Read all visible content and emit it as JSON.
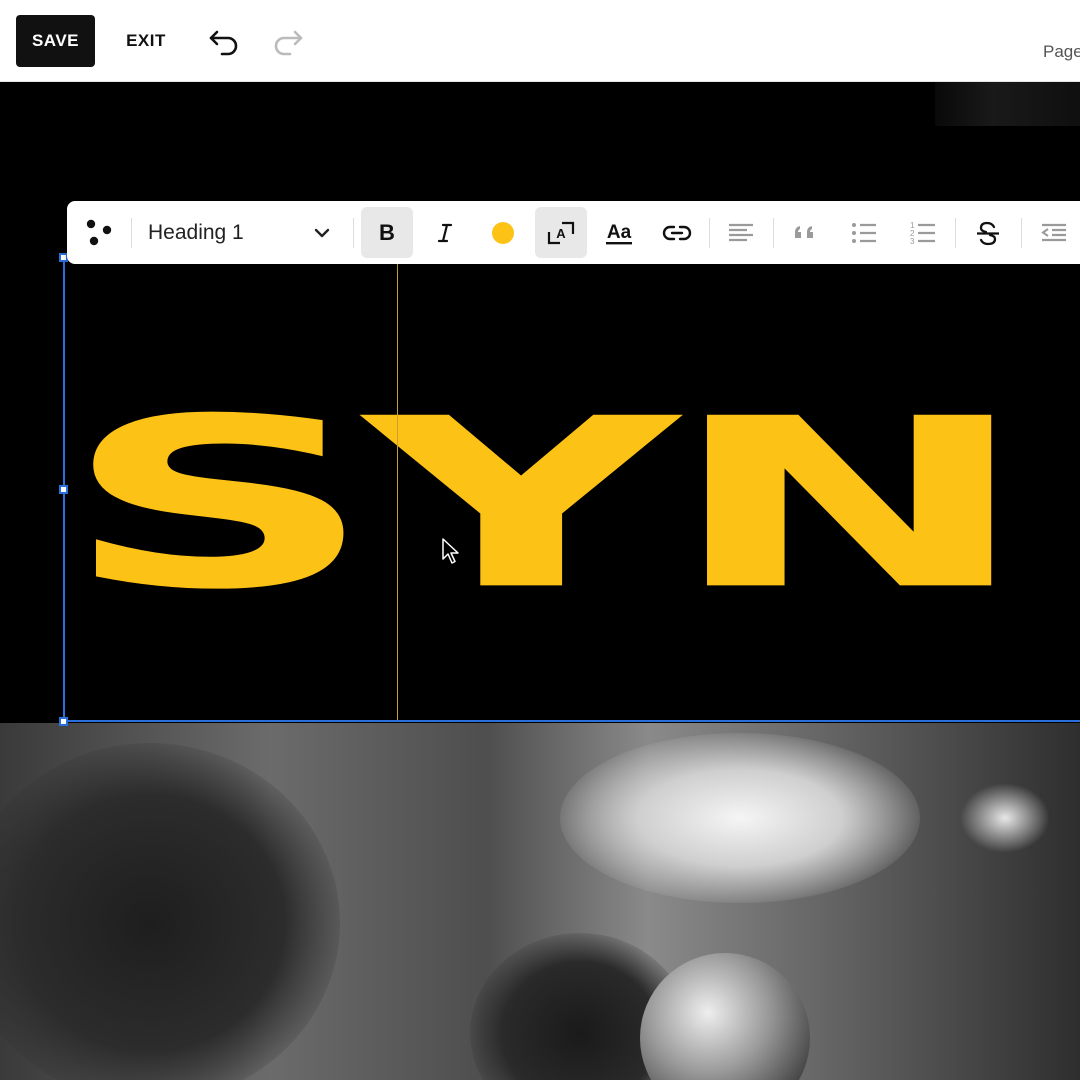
{
  "topbar": {
    "save_label": "SAVE",
    "exit_label": "EXIT",
    "pages_label": "Page"
  },
  "toolbar": {
    "text_style": "Heading 1",
    "text_color": "#fdc216",
    "icons": [
      "brand-dots-icon",
      "chevron-down-icon",
      "bold-icon",
      "italic-icon",
      "text-color-icon",
      "text-size-icon",
      "font-icon",
      "link-icon",
      "align-left-icon",
      "blockquote-icon",
      "bulleted-list-icon",
      "numbered-list-icon",
      "strikethrough-icon",
      "outdent-icon"
    ]
  },
  "hero": {
    "heading": "SYN"
  },
  "colors": {
    "accent": "#fdc216",
    "selection": "#2a6fdb",
    "topbar_button": "#111111"
  }
}
